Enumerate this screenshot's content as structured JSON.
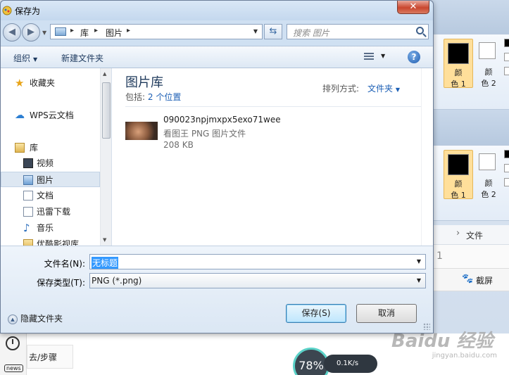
{
  "dialog": {
    "title": "保存为",
    "close_label": "✕"
  },
  "address": {
    "segments": [
      "库",
      "图片"
    ],
    "separator": "▸"
  },
  "search": {
    "placeholder": "搜索 图片"
  },
  "toolbar": {
    "organize": "组织",
    "new_folder": "新建文件夹",
    "help": "?"
  },
  "sidebar": {
    "items": [
      {
        "label": "收藏夹",
        "icon": "star-icon"
      },
      {
        "label": "WPS云文档",
        "icon": "cloud-icon"
      },
      {
        "label": "库",
        "icon": "library-icon"
      },
      {
        "label": "视频",
        "icon": "video-icon"
      },
      {
        "label": "图片",
        "icon": "picture-icon"
      },
      {
        "label": "文档",
        "icon": "document-icon"
      },
      {
        "label": "迅雷下载",
        "icon": "download-icon"
      },
      {
        "label": "音乐",
        "icon": "music-icon"
      },
      {
        "label": "优酷影视库",
        "icon": "folder-icon"
      }
    ]
  },
  "library": {
    "title": "图片库",
    "includes_label": "包括:",
    "includes_link": "2 个位置",
    "arrange_label": "排列方式:",
    "arrange_value": "文件夹"
  },
  "files": [
    {
      "name": "090023npjmxpx5exo71wee",
      "type": "看图王 PNG 图片文件",
      "size": "208 KB"
    }
  ],
  "form": {
    "filename_label": "文件名(N):",
    "filename_value": "无标题",
    "filetype_label": "保存类型(T):",
    "filetype_value": "PNG (*.png)",
    "hide_folders": "隐藏文件夹",
    "save": "保存(S)",
    "cancel": "取消"
  },
  "background": {
    "color1_label_a": "颜",
    "color1_label_b": "色 1",
    "color2_label_a": "颜",
    "color2_label_b": "色 2",
    "breadcrumb": "文件",
    "row_number": "1",
    "screenshot": "截屏",
    "step": "去/步骤",
    "news": "news",
    "speed_percent": "78%",
    "speed_rate": "0.1K/s",
    "watermark": "Baidu 经验",
    "watermark_sub": "jingyan.baidu.com"
  },
  "colors": {
    "accent": "#1c5fb5",
    "selection": "#3399ff",
    "close": "#c9462e",
    "color_slot": "#ffdf9a"
  }
}
